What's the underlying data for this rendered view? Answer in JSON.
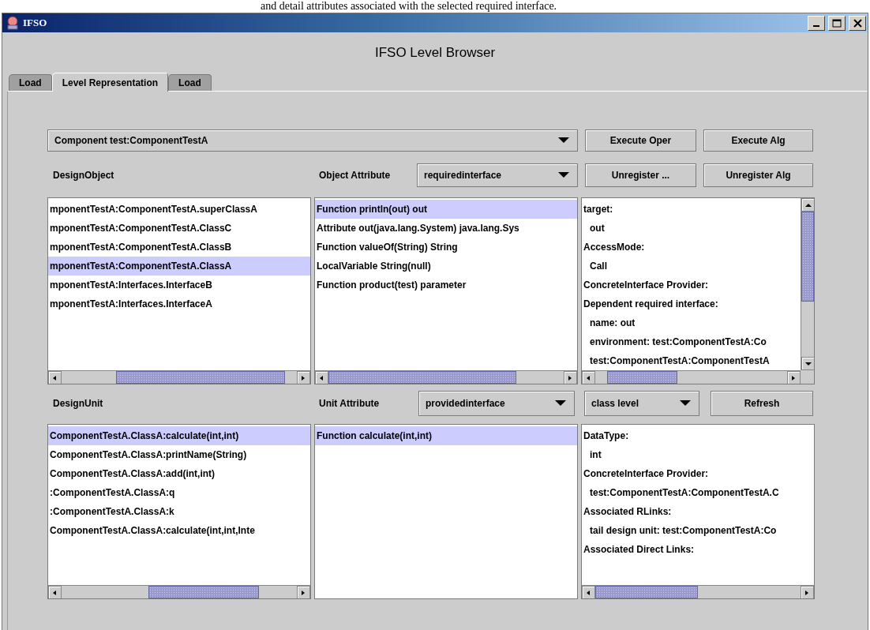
{
  "caption": "and detail attributes associated with the selected required interface.",
  "window": {
    "title": "IFSO"
  },
  "heading": "IFSO Level Browser",
  "tabs": [
    {
      "label": "Load",
      "selected": false
    },
    {
      "label": "Level Representation",
      "selected": true
    },
    {
      "label": "Load",
      "selected": false
    }
  ],
  "component_select": {
    "value": "Component test:ComponentTestA"
  },
  "top_buttons": [
    "Execute Oper",
    "Execute Alg"
  ],
  "design_object": {
    "label": "DesignObject",
    "items": [
      {
        "text": "mponentTestA:ComponentTestA.superClassA",
        "selected": false
      },
      {
        "text": "mponentTestA:ComponentTestA.ClassC",
        "selected": false
      },
      {
        "text": "mponentTestA:ComponentTestA.ClassB",
        "selected": false
      },
      {
        "text": "mponentTestA:ComponentTestA.ClassA",
        "selected": true
      },
      {
        "text": "mponentTestA:Interfaces.InterfaceB",
        "selected": false
      },
      {
        "text": "mponentTestA:Interfaces.InterfaceA",
        "selected": false
      }
    ]
  },
  "object_attribute": {
    "label": "Object Attribute",
    "select": "requiredinterface",
    "items": [
      {
        "text": "Function println(out) out",
        "selected": true
      },
      {
        "text": "Attribute out(java.lang.System) java.lang.Sys",
        "selected": false
      },
      {
        "text": "Function valueOf(String) String",
        "selected": false
      },
      {
        "text": "LocalVariable String(null)",
        "selected": false
      },
      {
        "text": "Function product(test) parameter",
        "selected": false
      }
    ]
  },
  "middle_buttons": [
    "Unregister ...",
    "Unregister Alg"
  ],
  "object_details": [
    {
      "text": "target:",
      "children": [
        {
          "text": "out"
        }
      ]
    },
    {
      "text": "AccessMode:",
      "children": [
        {
          "text": "Call"
        }
      ]
    },
    {
      "text": "ConcreteInterface Provider:"
    },
    {
      "text": "Dependent required interface:",
      "children": [
        {
          "text": "name: out"
        },
        {
          "text": "environment: test:ComponentTestA:Co"
        },
        {
          "text": "test:ComponentTestA:ComponentTestA"
        }
      ]
    }
  ],
  "design_unit": {
    "label": "DesignUnit",
    "items": [
      {
        "text": "ComponentTestA.ClassA:calculate(int,int)",
        "selected": true
      },
      {
        "text": "ComponentTestA.ClassA:printName(String)",
        "selected": false
      },
      {
        "text": "ComponentTestA.ClassA:add(int,int)",
        "selected": false
      },
      {
        "text": ":ComponentTestA.ClassA:q",
        "selected": false
      },
      {
        "text": ":ComponentTestA.ClassA:k",
        "selected": false
      },
      {
        "text": "ComponentTestA.ClassA:calculate(int,int,Inte",
        "selected": false
      }
    ]
  },
  "unit_attribute": {
    "label": "Unit Attribute",
    "select": "providedinterface",
    "items": [
      {
        "text": "Function calculate(int,int)",
        "selected": true
      }
    ]
  },
  "level_select": {
    "value": "class level"
  },
  "refresh_button": "Refresh",
  "unit_details": [
    {
      "text": "DataType:",
      "children": [
        {
          "text": "int"
        }
      ]
    },
    {
      "text": "ConcreteInterface Provider:",
      "children": [
        {
          "text": "test:ComponentTestA:ComponentTestA.C"
        }
      ]
    },
    {
      "text": "Associated RLinks:",
      "children": [
        {
          "text": "tail design unit: test:ComponentTestA:Co"
        }
      ]
    },
    {
      "text": "Associated Direct Links:"
    }
  ]
}
